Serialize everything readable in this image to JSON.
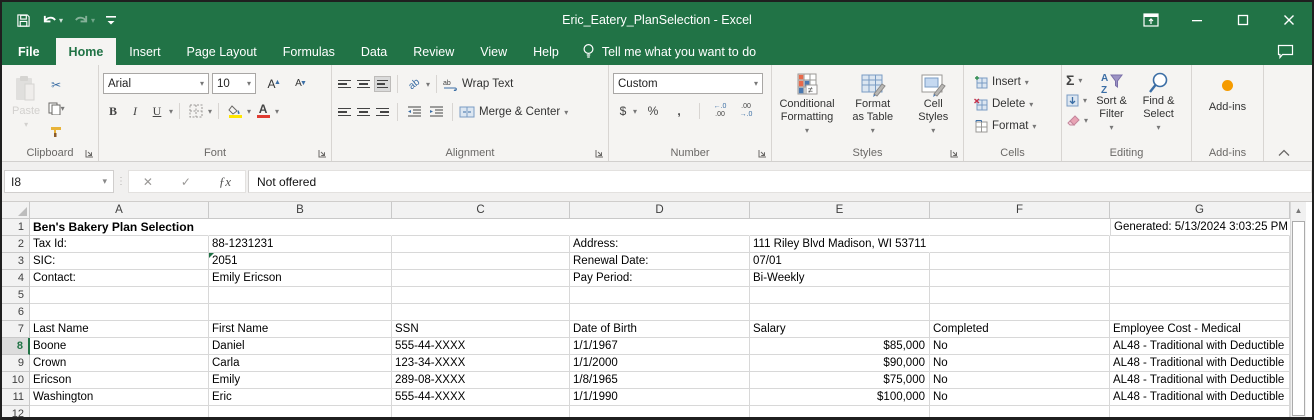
{
  "colors": {
    "excel_green": "#217346",
    "fill_color_swatch": "#ffe600",
    "font_color_swatch": "#e03c31",
    "addins_dot": "#f59b00",
    "error_indicator": "#1e7145"
  },
  "titlebar": {
    "title": "Eric_Eatery_PlanSelection  -  Excel",
    "qat": [
      "save",
      "undo",
      "redo",
      "customize-quick-access-toolbar"
    ]
  },
  "tabs": {
    "items": [
      "File",
      "Home",
      "Insert",
      "Page Layout",
      "Formulas",
      "Data",
      "Review",
      "View",
      "Help"
    ],
    "selected": "Home",
    "tell_me": "Tell me what you want to do"
  },
  "ribbon": {
    "clipboard": {
      "label": "Clipboard",
      "paste": "Paste"
    },
    "font": {
      "label": "Font",
      "font_name": "Arial",
      "font_size": "10"
    },
    "alignment": {
      "label": "Alignment",
      "wrap_text": "Wrap Text",
      "merge_center": "Merge & Center"
    },
    "number": {
      "label": "Number",
      "format": "Custom"
    },
    "styles": {
      "label": "Styles",
      "conditional": "Conditional Formatting",
      "format_table": "Format as Table",
      "cell_styles": "Cell Styles"
    },
    "cells": {
      "label": "Cells",
      "insert": "Insert",
      "delete": "Delete",
      "format": "Format"
    },
    "editing": {
      "label": "Editing",
      "sort_filter": "Sort & Filter",
      "find_select": "Find & Select"
    },
    "addins": {
      "label": "Add-ins",
      "button": "Add-ins"
    }
  },
  "formula_bar": {
    "name_box": "I8",
    "content": "Not offered"
  },
  "sheet": {
    "columns": [
      "A",
      "B",
      "C",
      "D",
      "E",
      "F",
      "G"
    ],
    "active_cell": "I8",
    "rows": [
      {
        "n": "1",
        "no_grid": true,
        "cells": [
          {
            "c": "A",
            "v": "Ben's Bakery Plan Selection",
            "bold": true
          },
          {
            "c": "G",
            "v": "Generated: 5/13/2024 3:03:25 PM",
            "clip": true
          }
        ]
      },
      {
        "n": "2",
        "cells": [
          {
            "c": "A",
            "v": "Tax Id:"
          },
          {
            "c": "B",
            "v": "88-1231231"
          },
          {
            "c": "D",
            "v": "Address:"
          },
          {
            "c": "E",
            "v": "111 Riley Blvd Madison, WI 53711",
            "overflow": true
          }
        ]
      },
      {
        "n": "3",
        "cells": [
          {
            "c": "A",
            "v": "SIC:"
          },
          {
            "c": "B",
            "v": "2051",
            "error": true
          },
          {
            "c": "D",
            "v": "Renewal Date:"
          },
          {
            "c": "E",
            "v": "07/01"
          }
        ]
      },
      {
        "n": "4",
        "cells": [
          {
            "c": "A",
            "v": "Contact:"
          },
          {
            "c": "B",
            "v": "Emily Ericson"
          },
          {
            "c": "D",
            "v": "Pay Period:"
          },
          {
            "c": "E",
            "v": "Bi-Weekly"
          }
        ]
      },
      {
        "n": "5",
        "cells": []
      },
      {
        "n": "6",
        "cells": []
      },
      {
        "n": "7",
        "cells": [
          {
            "c": "A",
            "v": "Last Name"
          },
          {
            "c": "B",
            "v": "First Name"
          },
          {
            "c": "C",
            "v": "SSN"
          },
          {
            "c": "D",
            "v": "Date of Birth"
          },
          {
            "c": "E",
            "v": "Salary"
          },
          {
            "c": "F",
            "v": "Completed"
          },
          {
            "c": "G",
            "v": "Employee Cost - Medical",
            "clip": true
          }
        ]
      },
      {
        "n": "8",
        "selected": true,
        "cells": [
          {
            "c": "A",
            "v": "Boone"
          },
          {
            "c": "B",
            "v": "Daniel"
          },
          {
            "c": "C",
            "v": "555-44-XXXX"
          },
          {
            "c": "D",
            "v": "1/1/1967"
          },
          {
            "c": "E",
            "v": "$85,000",
            "align": "right"
          },
          {
            "c": "F",
            "v": "No"
          },
          {
            "c": "G",
            "v": "AL48 - Traditional with Deductible",
            "clip": true
          }
        ]
      },
      {
        "n": "9",
        "cells": [
          {
            "c": "A",
            "v": "Crown"
          },
          {
            "c": "B",
            "v": "Carla"
          },
          {
            "c": "C",
            "v": "123-34-XXXX"
          },
          {
            "c": "D",
            "v": "1/1/2000"
          },
          {
            "c": "E",
            "v": "$90,000",
            "align": "right"
          },
          {
            "c": "F",
            "v": "No"
          },
          {
            "c": "G",
            "v": "AL48 - Traditional with Deductible",
            "clip": true
          }
        ]
      },
      {
        "n": "10",
        "cells": [
          {
            "c": "A",
            "v": "Ericson"
          },
          {
            "c": "B",
            "v": "Emily"
          },
          {
            "c": "C",
            "v": "289-08-XXXX"
          },
          {
            "c": "D",
            "v": "1/8/1965"
          },
          {
            "c": "E",
            "v": "$75,000",
            "align": "right"
          },
          {
            "c": "F",
            "v": "No"
          },
          {
            "c": "G",
            "v": "AL48 - Traditional with Deductible",
            "clip": true
          }
        ]
      },
      {
        "n": "11",
        "cells": [
          {
            "c": "A",
            "v": "Washington"
          },
          {
            "c": "B",
            "v": "Eric"
          },
          {
            "c": "C",
            "v": "555-44-XXXX"
          },
          {
            "c": "D",
            "v": "1/1/1990"
          },
          {
            "c": "E",
            "v": "$100,000",
            "align": "right"
          },
          {
            "c": "F",
            "v": "No"
          },
          {
            "c": "G",
            "v": "AL48 - Traditional with Deductible",
            "clip": true
          }
        ]
      },
      {
        "n": "12",
        "cells": []
      }
    ]
  }
}
